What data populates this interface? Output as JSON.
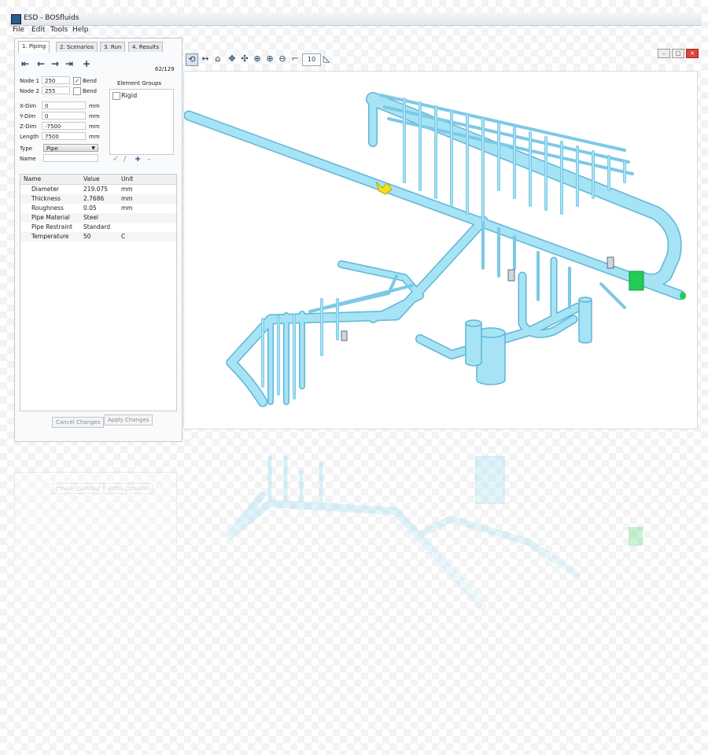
{
  "window": {
    "title": "ESD - BOSfluids"
  },
  "menu": [
    "File",
    "Edit",
    "Tools",
    "Help"
  ],
  "tabs": [
    "1. Piping",
    "2. Scenarios",
    "3. Run",
    "4. Results"
  ],
  "node_counter": "62/129",
  "element": {
    "node1_label": "Node 1",
    "node1_value": "250",
    "node1_bend": true,
    "node2_label": "Node 2",
    "node2_value": "255",
    "node2_bend": false,
    "bend_label": "Bend",
    "xdim_label": "X-Dim",
    "xdim_value": "0",
    "xdim_unit": "mm",
    "ydim_label": "Y-Dim",
    "ydim_value": "0",
    "ydim_unit": "mm",
    "zdim_label": "Z-Dim",
    "zdim_value": "-7500",
    "zdim_unit": "mm",
    "length_label": "Length",
    "length_value": "7500",
    "length_unit": "mm",
    "type_label": "Type",
    "type_value": "Pipe",
    "name_label": "Name",
    "name_value": ""
  },
  "element_groups": {
    "title": "Element Groups",
    "items": [
      {
        "label": "Rigid",
        "checked": false
      }
    ]
  },
  "properties": {
    "headers": [
      "Name",
      "Value",
      "Unit"
    ],
    "rows": [
      {
        "name": "Diameter",
        "value": "219.075",
        "unit": "mm"
      },
      {
        "name": "Thickness",
        "value": "2.7686",
        "unit": "mm"
      },
      {
        "name": "Roughness",
        "value": "0.05",
        "unit": "mm"
      },
      {
        "name": "Pipe Material",
        "value": "Steel",
        "unit": ""
      },
      {
        "name": "Pipe Restraint",
        "value": "Standard",
        "unit": ""
      },
      {
        "name": "Temperature",
        "value": "50",
        "unit": "C"
      }
    ]
  },
  "buttons": {
    "cancel": "Cancel Changes",
    "apply": "Apply Changes"
  },
  "toolbar": {
    "spin_value": "10"
  },
  "colors": {
    "pipe": "#8fd8ef",
    "pipe_edge": "#5fb6d6",
    "valve": "#f2e21a",
    "flange": "#22cc55",
    "accent": "#1d3f66"
  },
  "icons": {
    "nav": [
      "first-icon",
      "prev-icon",
      "next-icon",
      "last-icon",
      "add-icon"
    ],
    "toolbar": [
      "rotate-icon",
      "pan-icon",
      "frame-icon",
      "center-icon",
      "orbit-icon",
      "zoom-icon",
      "zoom-in-icon",
      "zoom-out-icon",
      "snap-icon",
      "spin-icon",
      "measure-icon"
    ]
  }
}
